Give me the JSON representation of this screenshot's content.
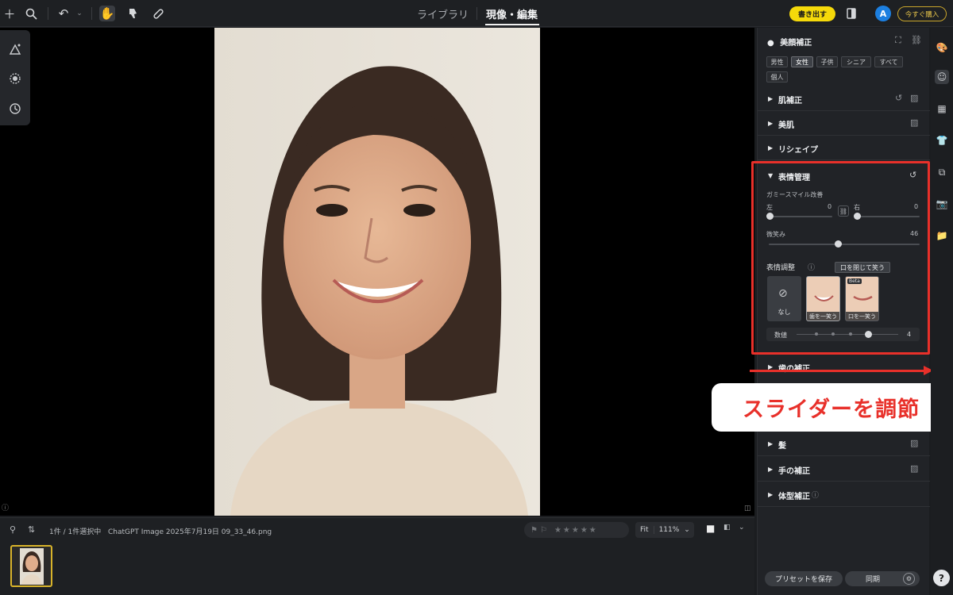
{
  "topbar": {
    "tab_library": "ライブラリ",
    "tab_develop": "現像・編集",
    "export_label": "書き出す",
    "avatar_letter": "A",
    "buy_label": "今すぐ購入"
  },
  "filmstrip": {
    "selection_count": "1件 / 1件選択中",
    "filename": "ChatGPT Image 2025年7月19日 09_33_46.png",
    "fit_label": "Fit",
    "zoom_label": "111%",
    "stars": "★★★★★"
  },
  "panel": {
    "title": "美顔補正",
    "filters": [
      "男性",
      "女性",
      "子供",
      "シニア",
      "すべて",
      "個人"
    ],
    "sections_top": [
      "肌補正",
      "美肌",
      "リシェイプ"
    ],
    "expression": {
      "title": "表情管理",
      "gummy_label": "ガミースマイル改善",
      "left_label": "左",
      "left_value": "0",
      "right_label": "右",
      "right_value": "0",
      "smile_label": "微笑み",
      "smile_value": "46",
      "smile_fraction": 0.46,
      "adjust_label": "表情調整",
      "tooltip": "口を閉じて笑う",
      "none_label": "なし",
      "tile1_caption": "歯を一笑う",
      "tile2_caption": "口を一笑う",
      "beta": "Beta",
      "amount_label": "数値",
      "amount_value": "4"
    },
    "teeth_label": "歯の補正",
    "sections_bottom": [
      "髪",
      "手の補正",
      "体型補正"
    ],
    "preset_label": "プリセットを保存",
    "sync_label": "同期"
  },
  "annotation": {
    "text": "スライダーを調節",
    "color": "#e8302a"
  }
}
